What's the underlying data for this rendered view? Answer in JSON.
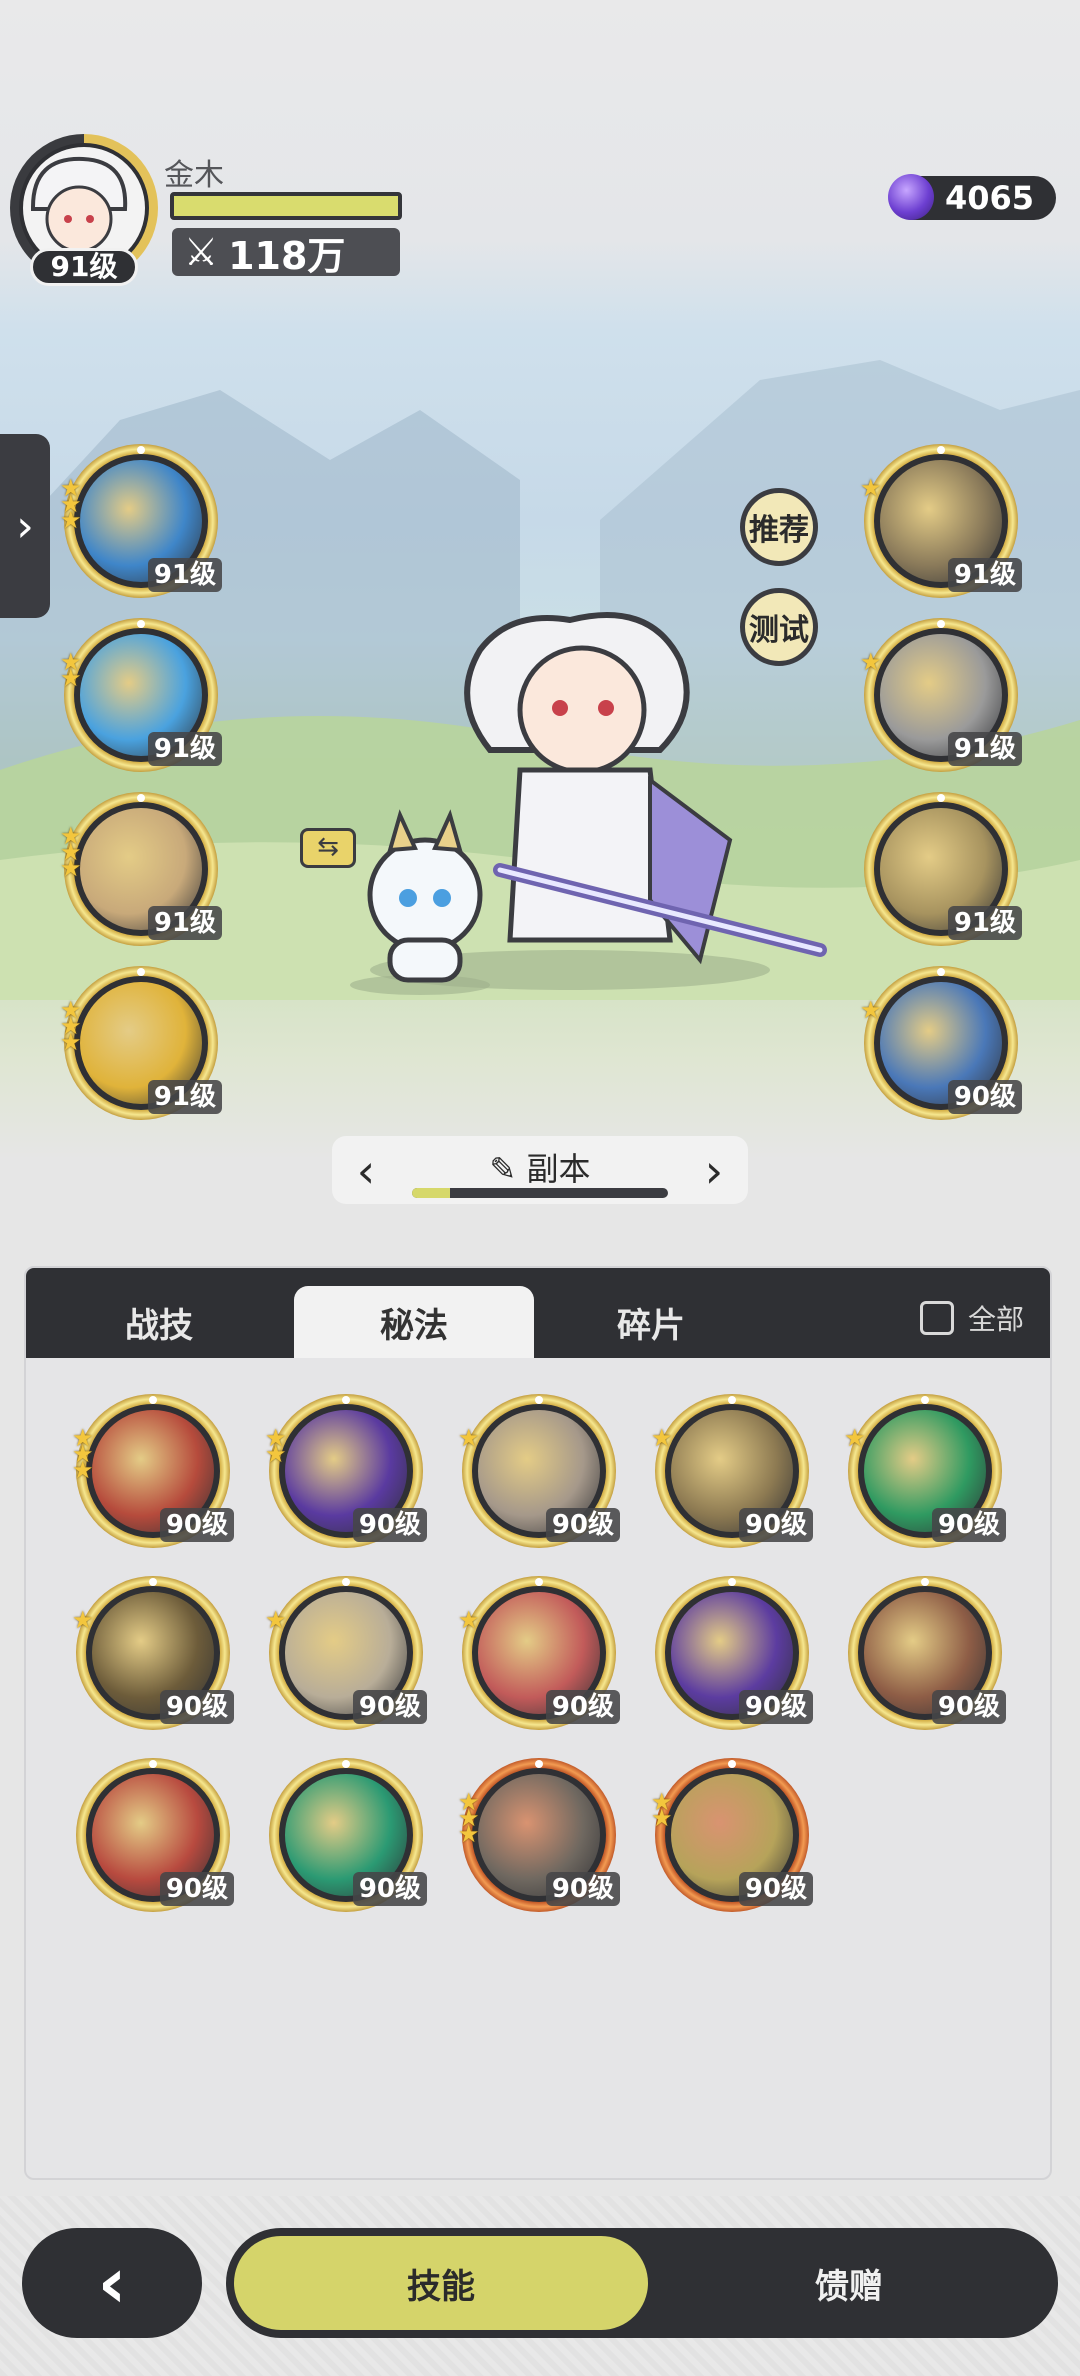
{
  "player": {
    "name": "金木",
    "level": "91级",
    "power": "118万",
    "hp_fraction": 1.0
  },
  "currency": {
    "amount": "4065",
    "icon": "gem-icon"
  },
  "left_skills": [
    {
      "level": "91级",
      "stars": 3,
      "color": "#3f86c9"
    },
    {
      "level": "91级",
      "stars": 2,
      "color": "#4aa2df"
    },
    {
      "level": "91级",
      "stars": 3,
      "color": "#c8a97a"
    },
    {
      "level": "91级",
      "stars": 3,
      "color": "#e0b33a"
    }
  ],
  "right_skills": [
    {
      "level": "91级",
      "stars": 1,
      "color": "#8a7a5a"
    },
    {
      "level": "91级",
      "stars": 1,
      "color": "#9a9a9a"
    },
    {
      "level": "91级",
      "stars": 0,
      "color": "#a7935f"
    },
    {
      "level": "90级",
      "stars": 1,
      "color": "#4a78b8"
    }
  ],
  "actions": {
    "recommend": "推荐",
    "test": "测试"
  },
  "dungeon": {
    "label": "副本",
    "progress": 0.15
  },
  "tabs": {
    "combat": "战技",
    "arcane": "秘法",
    "fragments": "碎片",
    "all": "全部"
  },
  "grid_skills": [
    {
      "level": "90级",
      "stars": 3,
      "color": "#b64b3c",
      "frame": "gold"
    },
    {
      "level": "90级",
      "stars": 2,
      "color": "#5a3aa0",
      "frame": "gold"
    },
    {
      "level": "90级",
      "stars": 1,
      "color": "#a5988a",
      "frame": "gold"
    },
    {
      "level": "90级",
      "stars": 1,
      "color": "#8d7a52",
      "frame": "gold"
    },
    {
      "level": "90级",
      "stars": 1,
      "color": "#2f9a61",
      "frame": "gold"
    },
    {
      "level": "90级",
      "stars": 1,
      "color": "#6d5c3a",
      "frame": "gold"
    },
    {
      "level": "90级",
      "stars": 1,
      "color": "#b8ad98",
      "frame": "gold"
    },
    {
      "level": "90级",
      "stars": 1,
      "color": "#c25b5a",
      "frame": "gold"
    },
    {
      "level": "90级",
      "stars": 0,
      "color": "#5c3ca0",
      "frame": "gold"
    },
    {
      "level": "90级",
      "stars": 0,
      "color": "#8e5d46",
      "frame": "gold"
    },
    {
      "level": "90级",
      "stars": 0,
      "color": "#b84a3f",
      "frame": "gold"
    },
    {
      "level": "90级",
      "stars": 0,
      "color": "#2b9a73",
      "frame": "gold"
    },
    {
      "level": "90级",
      "stars": 3,
      "color": "#6f6860",
      "frame": "orange"
    },
    {
      "level": "90级",
      "stars": 2,
      "color": "#b6a35a",
      "frame": "orange"
    }
  ],
  "bottom": {
    "skills": "技能",
    "gift": "馈赠"
  }
}
